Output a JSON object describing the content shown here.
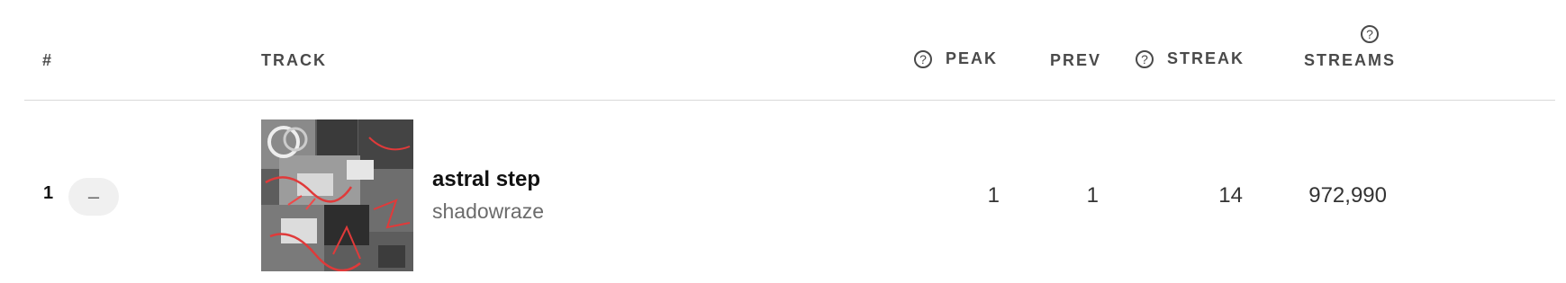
{
  "columns": {
    "rank": "#",
    "track": "TRACK",
    "peak": "PEAK",
    "prev": "PREV",
    "streak": "STREAK",
    "streams": "STREAMS",
    "help_glyph": "?"
  },
  "rows": [
    {
      "rank": "1",
      "change": "–",
      "title": "astral step",
      "artist": "shadowraze",
      "peak": "1",
      "prev": "1",
      "streak": "14",
      "streams": "972,990"
    }
  ],
  "colors": {
    "accent": "#e03a3a",
    "cover_base": "#5a5a5a"
  },
  "icons": [
    "help-icon"
  ]
}
